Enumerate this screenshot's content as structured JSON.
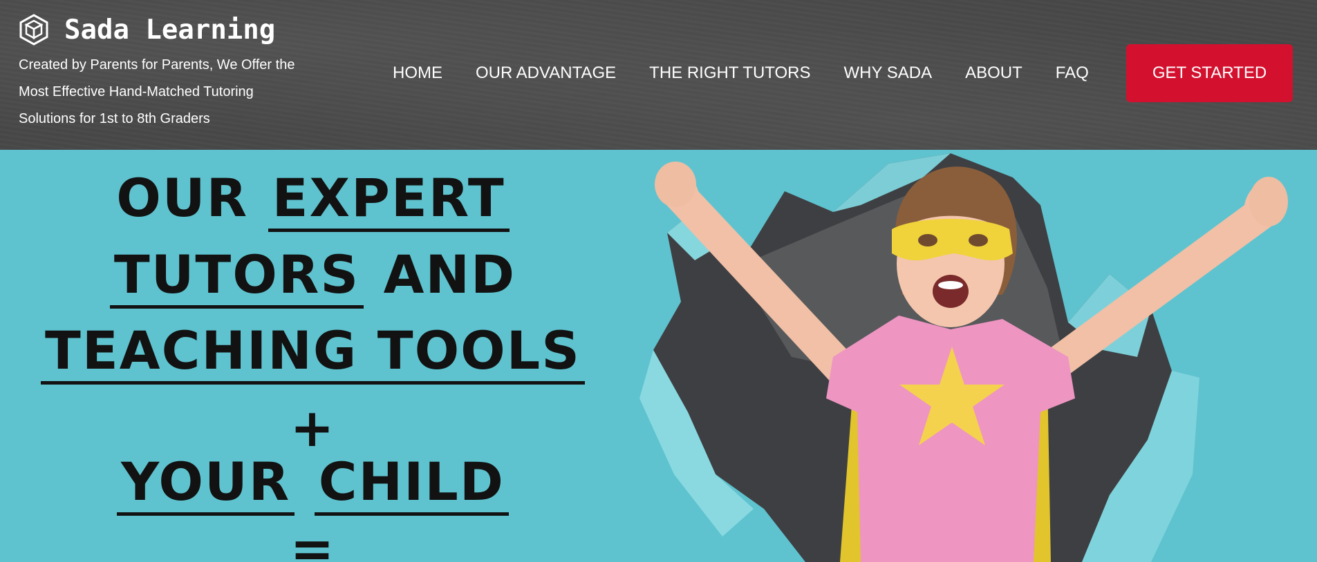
{
  "header": {
    "brand_name": "Sada Learning",
    "logo_icon": "hexagon-cube-logo",
    "tagline_lines": [
      "Created by Parents for Parents, We Offer the",
      "Most Effective Hand-Matched Tutoring",
      "Solutions for 1st to 8th Graders"
    ]
  },
  "nav": {
    "items": [
      "HOME",
      "OUR ADVANTAGE",
      "THE RIGHT TUTORS",
      "WHY SADA",
      "ABOUT",
      "FAQ"
    ],
    "cta_label": "GET STARTED"
  },
  "hero": {
    "headline": {
      "line1_a": "OUR",
      "line1_b": "EXPERT",
      "line2_a": "TUTORS",
      "line2_b": "AND",
      "line3": "TEACHING TOOLS",
      "line4": "+",
      "line5_a": "YOUR",
      "line5_b": "CHILD",
      "line6": "="
    },
    "image_subject": "girl-superhero-photo"
  },
  "colors": {
    "header_bg": "#484848",
    "cta_bg": "#d3112f",
    "hero_bg": "#5ec3cf",
    "text_light": "#ffffff",
    "headline_text": "#121212"
  }
}
